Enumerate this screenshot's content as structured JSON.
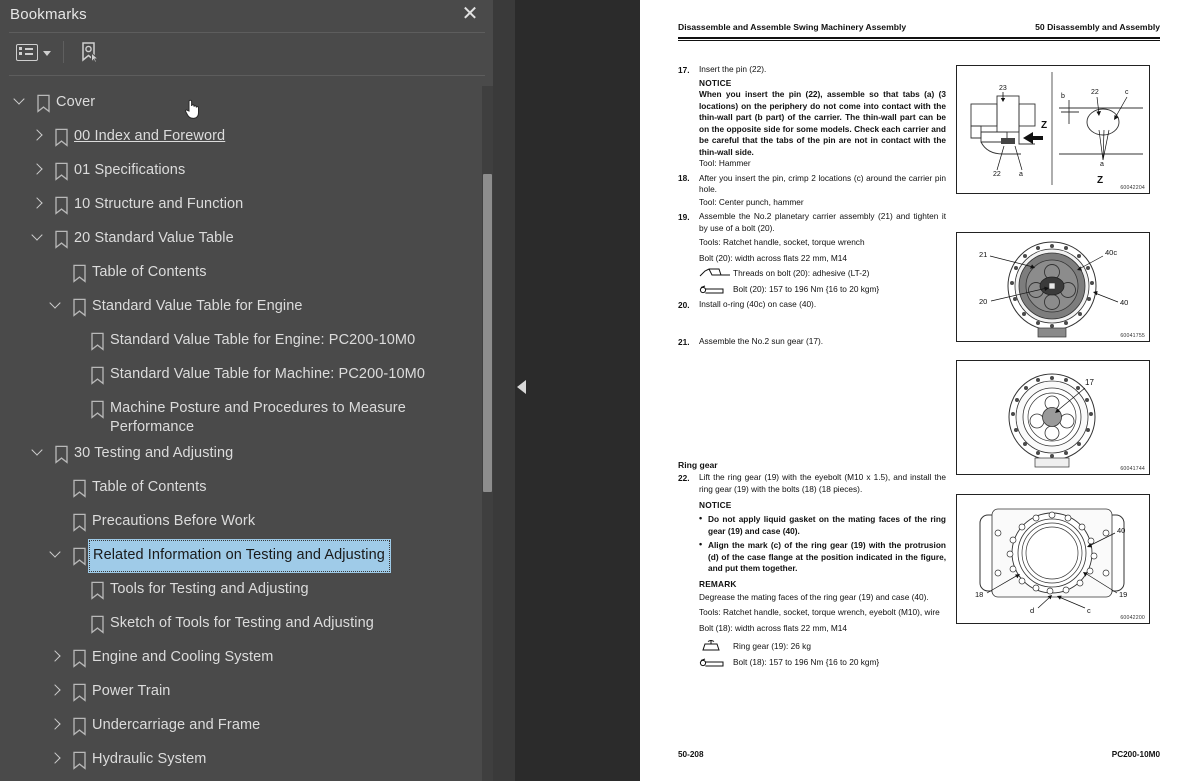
{
  "panel": {
    "title": "Bookmarks",
    "close_icon": "close-icon",
    "toolbar": {
      "options_label": "Bookmark options",
      "list_icon": "list-options-icon",
      "caret_icon": "chevron-down-icon",
      "new_bookmark_icon": "new-bookmark-icon"
    },
    "collapse_icon": "collapse-panel-arrow-icon",
    "items": [
      {
        "label": "Cover",
        "level": 0,
        "twisty": "down",
        "selected": false,
        "underlined": false
      },
      {
        "label": "00 Index and Foreword",
        "level": 1,
        "twisty": "right",
        "selected": false,
        "underlined": true
      },
      {
        "label": "01 Specifications",
        "level": 1,
        "twisty": "right",
        "selected": false,
        "underlined": false
      },
      {
        "label": "10 Structure and Function",
        "level": 1,
        "twisty": "right",
        "selected": false,
        "underlined": false
      },
      {
        "label": "20 Standard Value Table",
        "level": 1,
        "twisty": "down",
        "selected": false,
        "underlined": false
      },
      {
        "label": "Table of Contents",
        "level": 2,
        "twisty": "none",
        "selected": false,
        "underlined": false
      },
      {
        "label": "Standard Value Table for Engine",
        "level": 2,
        "twisty": "down",
        "selected": false,
        "underlined": false
      },
      {
        "label": "Standard Value Table for Engine: PC200-10M0",
        "level": 3,
        "twisty": "none",
        "selected": false,
        "underlined": false
      },
      {
        "label": "Standard Value Table for Machine: PC200-10M0",
        "level": 3,
        "twisty": "none",
        "selected": false,
        "underlined": false
      },
      {
        "label": "Machine Posture and Procedures to Measure Performance",
        "level": 3,
        "twisty": "none",
        "selected": false,
        "underlined": false
      },
      {
        "label": "30 Testing and Adjusting",
        "level": 1,
        "twisty": "down",
        "selected": false,
        "underlined": false
      },
      {
        "label": "Table of Contents",
        "level": 2,
        "twisty": "none",
        "selected": false,
        "underlined": false
      },
      {
        "label": "Precautions Before Work",
        "level": 2,
        "twisty": "none",
        "selected": false,
        "underlined": false
      },
      {
        "label": "Related Information on Testing and Adjusting",
        "level": 2,
        "twisty": "down",
        "selected": true,
        "underlined": false
      },
      {
        "label": "Tools for Testing and Adjusting",
        "level": 3,
        "twisty": "none",
        "selected": false,
        "underlined": false
      },
      {
        "label": "Sketch of Tools for Testing and Adjusting",
        "level": 3,
        "twisty": "none",
        "selected": false,
        "underlined": false
      },
      {
        "label": "Engine and Cooling System",
        "level": 2,
        "twisty": "right",
        "selected": false,
        "underlined": false
      },
      {
        "label": "Power Train",
        "level": 2,
        "twisty": "right",
        "selected": false,
        "underlined": false
      },
      {
        "label": "Undercarriage and Frame",
        "level": 2,
        "twisty": "right",
        "selected": false,
        "underlined": false
      },
      {
        "label": "Hydraulic System",
        "level": 2,
        "twisty": "right",
        "selected": false,
        "underlined": false
      }
    ]
  },
  "document": {
    "header_left": "Disassemble and Assemble Swing Machinery Assembly",
    "header_right": "50 Disassembly and Assembly",
    "footer_left": "50-208",
    "footer_right": "PC200-10M0",
    "steps": {
      "s17": {
        "num": "17.",
        "text": "Insert the pin (22).",
        "notice_label": "NOTICE",
        "notice_body": "When you insert the pin (22), assemble so that tabs (a) (3 locations) on the periphery do not come into contact with the thin-wall part (b part) of the carrier. The thin-wall part can be on the opposite side for some models. Check each carrier and be careful that the tabs of the pin are not in contact with the thin-wall side.",
        "tool": "Tool: Hammer"
      },
      "s18": {
        "num": "18.",
        "text": "After you insert the pin, crimp 2 locations (c) around the carrier pin hole.",
        "tool": "Tool: Center punch, hammer"
      },
      "s19": {
        "num": "19.",
        "text": "Assemble the No.2 planetary carrier assembly (21) and tighten it by use of a bolt (20).",
        "tools": "Tools: Ratchet handle, socket, torque wrench",
        "bolt_spec": "Bolt (20): width across flats 22 mm, M14",
        "adhesive": "Threads on bolt (20): adhesive (LT-2)",
        "torque": "Bolt (20): 157 to 196 Nm {16 to 20 kgm}"
      },
      "s20": {
        "num": "20.",
        "text": "Install o-ring (40c) on case (40)."
      },
      "s21": {
        "num": "21.",
        "text": "Assemble the No.2 sun gear (17)."
      },
      "ring_gear_heading": "Ring gear",
      "s22": {
        "num": "22.",
        "text": "Lift the ring gear (19) with the eyebolt (M10 x 1.5), and install the ring gear (19) with the bolts (18) (18 pieces).",
        "notice_label": "NOTICE",
        "bullet1": "Do not apply liquid gasket on the mating faces of the ring gear (19) and case (40).",
        "bullet2": "Align the mark (c) of the ring gear (19) with the protrusion (d) of the case flange at the position indicated in the figure, and put them together.",
        "remark_label": "REMARK",
        "remark_body": "Degrease the mating faces of the ring gear (19) and case (40).",
        "tools": "Tools: Ratchet handle, socket, torque wrench, eyebolt (M10), wire",
        "bolt_spec": "Bolt (18): width across flats 22 mm, M14",
        "weight": "Ring gear (19): 26 kg",
        "torque": "Bolt (18): 157 to 196 Nm {16 to 20 kgm}"
      }
    },
    "figures": [
      {
        "id": "60042204",
        "name": "figure-pin-tabs",
        "callouts": [
          "23",
          "22",
          "a",
          "b",
          "c",
          "Z"
        ]
      },
      {
        "id": "60041755",
        "name": "figure-planetary-carrier",
        "callouts": [
          "21",
          "20",
          "40c",
          "40"
        ]
      },
      {
        "id": "60041744",
        "name": "figure-sun-gear",
        "callouts": [
          "17"
        ]
      },
      {
        "id": "60042200",
        "name": "figure-ring-gear",
        "callouts": [
          "18",
          "19",
          "40",
          "c",
          "d"
        ]
      }
    ]
  },
  "colors": {
    "panel_bg": "#4a4a4a",
    "selection": "#9fcbe8",
    "text": "#dcdcdc",
    "page_bg": "#ffffff"
  }
}
